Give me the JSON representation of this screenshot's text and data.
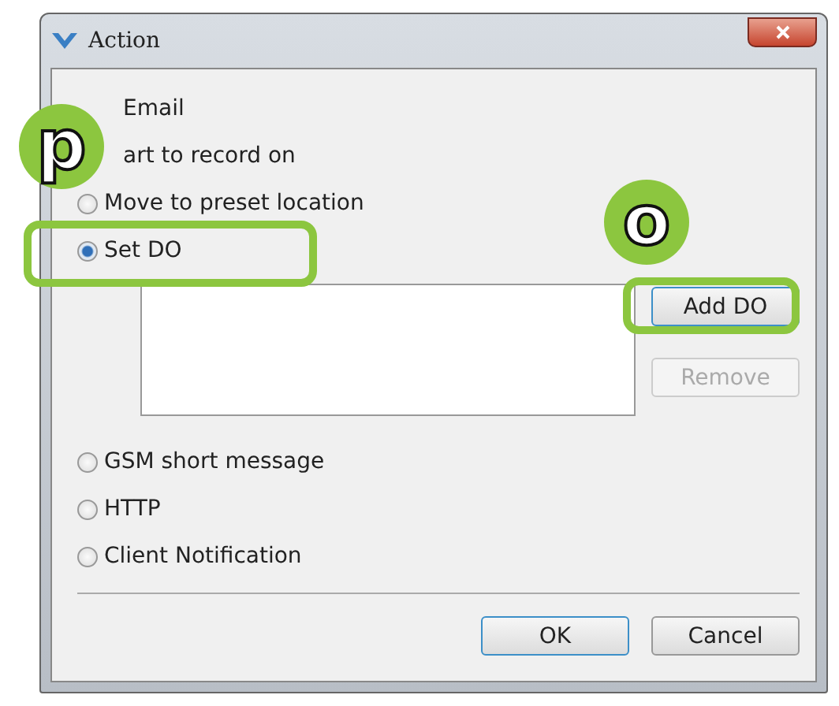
{
  "window": {
    "title": "Action"
  },
  "options": [
    {
      "label": "Email",
      "kind": "covered"
    },
    {
      "label": "art to record on",
      "kind": "covered"
    },
    {
      "label": "Move to preset location",
      "selected": false
    },
    {
      "label": "Set DO",
      "selected": true
    }
  ],
  "do_list": {
    "add_button": {
      "label": "Add DO",
      "disabled": false
    },
    "remove_button": {
      "label": "Remove",
      "disabled": true
    }
  },
  "more_options": [
    {
      "label": "GSM short message",
      "selected": false
    },
    {
      "label": "HTTP",
      "selected": false
    },
    {
      "label": "Client Notification",
      "selected": false
    }
  ],
  "buttons": [
    "OK",
    "Cancel"
  ],
  "callouts": [
    {
      "label": "p"
    },
    {
      "label": "o"
    }
  ]
}
